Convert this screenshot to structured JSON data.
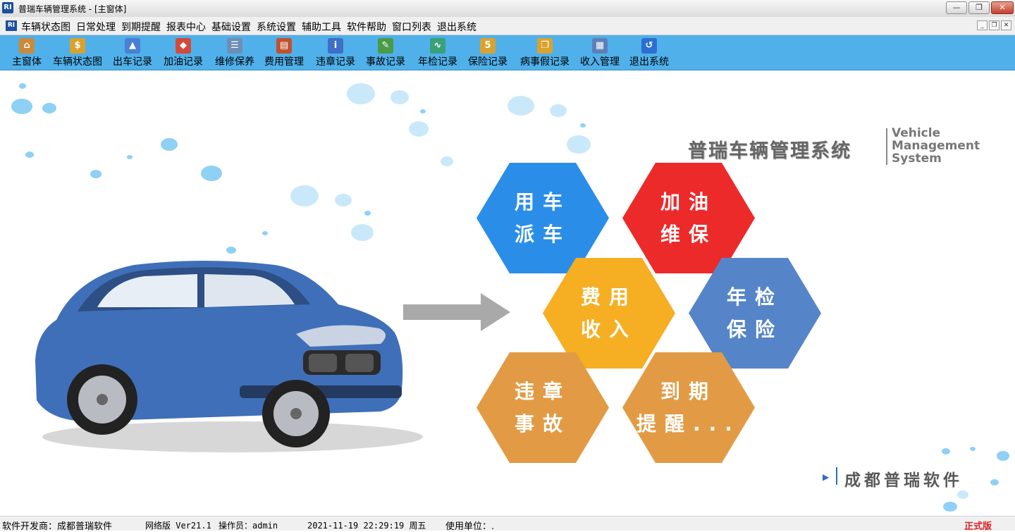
{
  "window": {
    "title": "普瑞车辆管理系统 - [主窗体]",
    "icon": "app-logo-icon"
  },
  "menu": [
    "车辆状态图",
    "日常处理",
    "到期提醒",
    "报表中心",
    "基础设置",
    "系统设置",
    "辅助工具",
    "软件帮助",
    "窗口列表",
    "退出系统"
  ],
  "toolbar": [
    {
      "label": "主窗体",
      "icon": "home-icon",
      "color": "#c98a3c"
    },
    {
      "label": "车辆状态图",
      "icon": "coins-icon",
      "color": "#d9a230"
    },
    {
      "label": "出车记录",
      "icon": "dispatch-icon",
      "color": "#4a7fd4"
    },
    {
      "label": "加油记录",
      "icon": "fuel-icon",
      "color": "#d24a3a"
    },
    {
      "label": "维修保养",
      "icon": "repair-icon",
      "color": "#6d8fb5"
    },
    {
      "label": "费用管理",
      "icon": "book-icon",
      "color": "#c0522e"
    },
    {
      "label": "违章记录",
      "icon": "info-icon",
      "color": "#3f6fc6"
    },
    {
      "label": "事故记录",
      "icon": "accident-icon",
      "color": "#4a9a48"
    },
    {
      "label": "年检记录",
      "icon": "chart-icon",
      "color": "#3aa07a"
    },
    {
      "label": "保险记录",
      "icon": "calendar-icon",
      "color": "#d9a230"
    },
    {
      "label": "病事假记录",
      "icon": "clipboard-icon",
      "color": "#d9a230"
    },
    {
      "label": "收入管理",
      "icon": "grid-icon",
      "color": "#5d7fb8"
    },
    {
      "label": "退出系统",
      "icon": "exit-icon",
      "color": "#2d6fcf"
    }
  ],
  "logo": {
    "cn": "普瑞车辆管理系统",
    "en": [
      "Vehicle",
      "Management",
      "System"
    ]
  },
  "hexes": [
    {
      "lines": [
        "用车",
        "派车"
      ],
      "color": "#2a8ee8"
    },
    {
      "lines": [
        "加油",
        "维保"
      ],
      "color": "#ec2a2a"
    },
    {
      "lines": [
        "费用",
        "收入"
      ],
      "color": "#f6ae22"
    },
    {
      "lines": [
        "年检",
        "保险"
      ],
      "color": "#5585c8"
    },
    {
      "lines": [
        "违章",
        "事故"
      ],
      "color": "#e29b44"
    },
    {
      "lines": [
        "到期",
        "提醒..."
      ],
      "color": "#e29b44"
    }
  ],
  "brand": "成都普瑞软件",
  "status": {
    "developer": "软件开发商：成都普瑞软件",
    "version": "网络版 Ver21.1",
    "operator": "操作员：admin",
    "datetime": "2021-11-19 22:29:19 周五",
    "unit": "使用单位：.",
    "edition": "正式版"
  },
  "colors": {
    "toolbar_bg": "#4fb0ea",
    "edition_text": "#e02020"
  }
}
